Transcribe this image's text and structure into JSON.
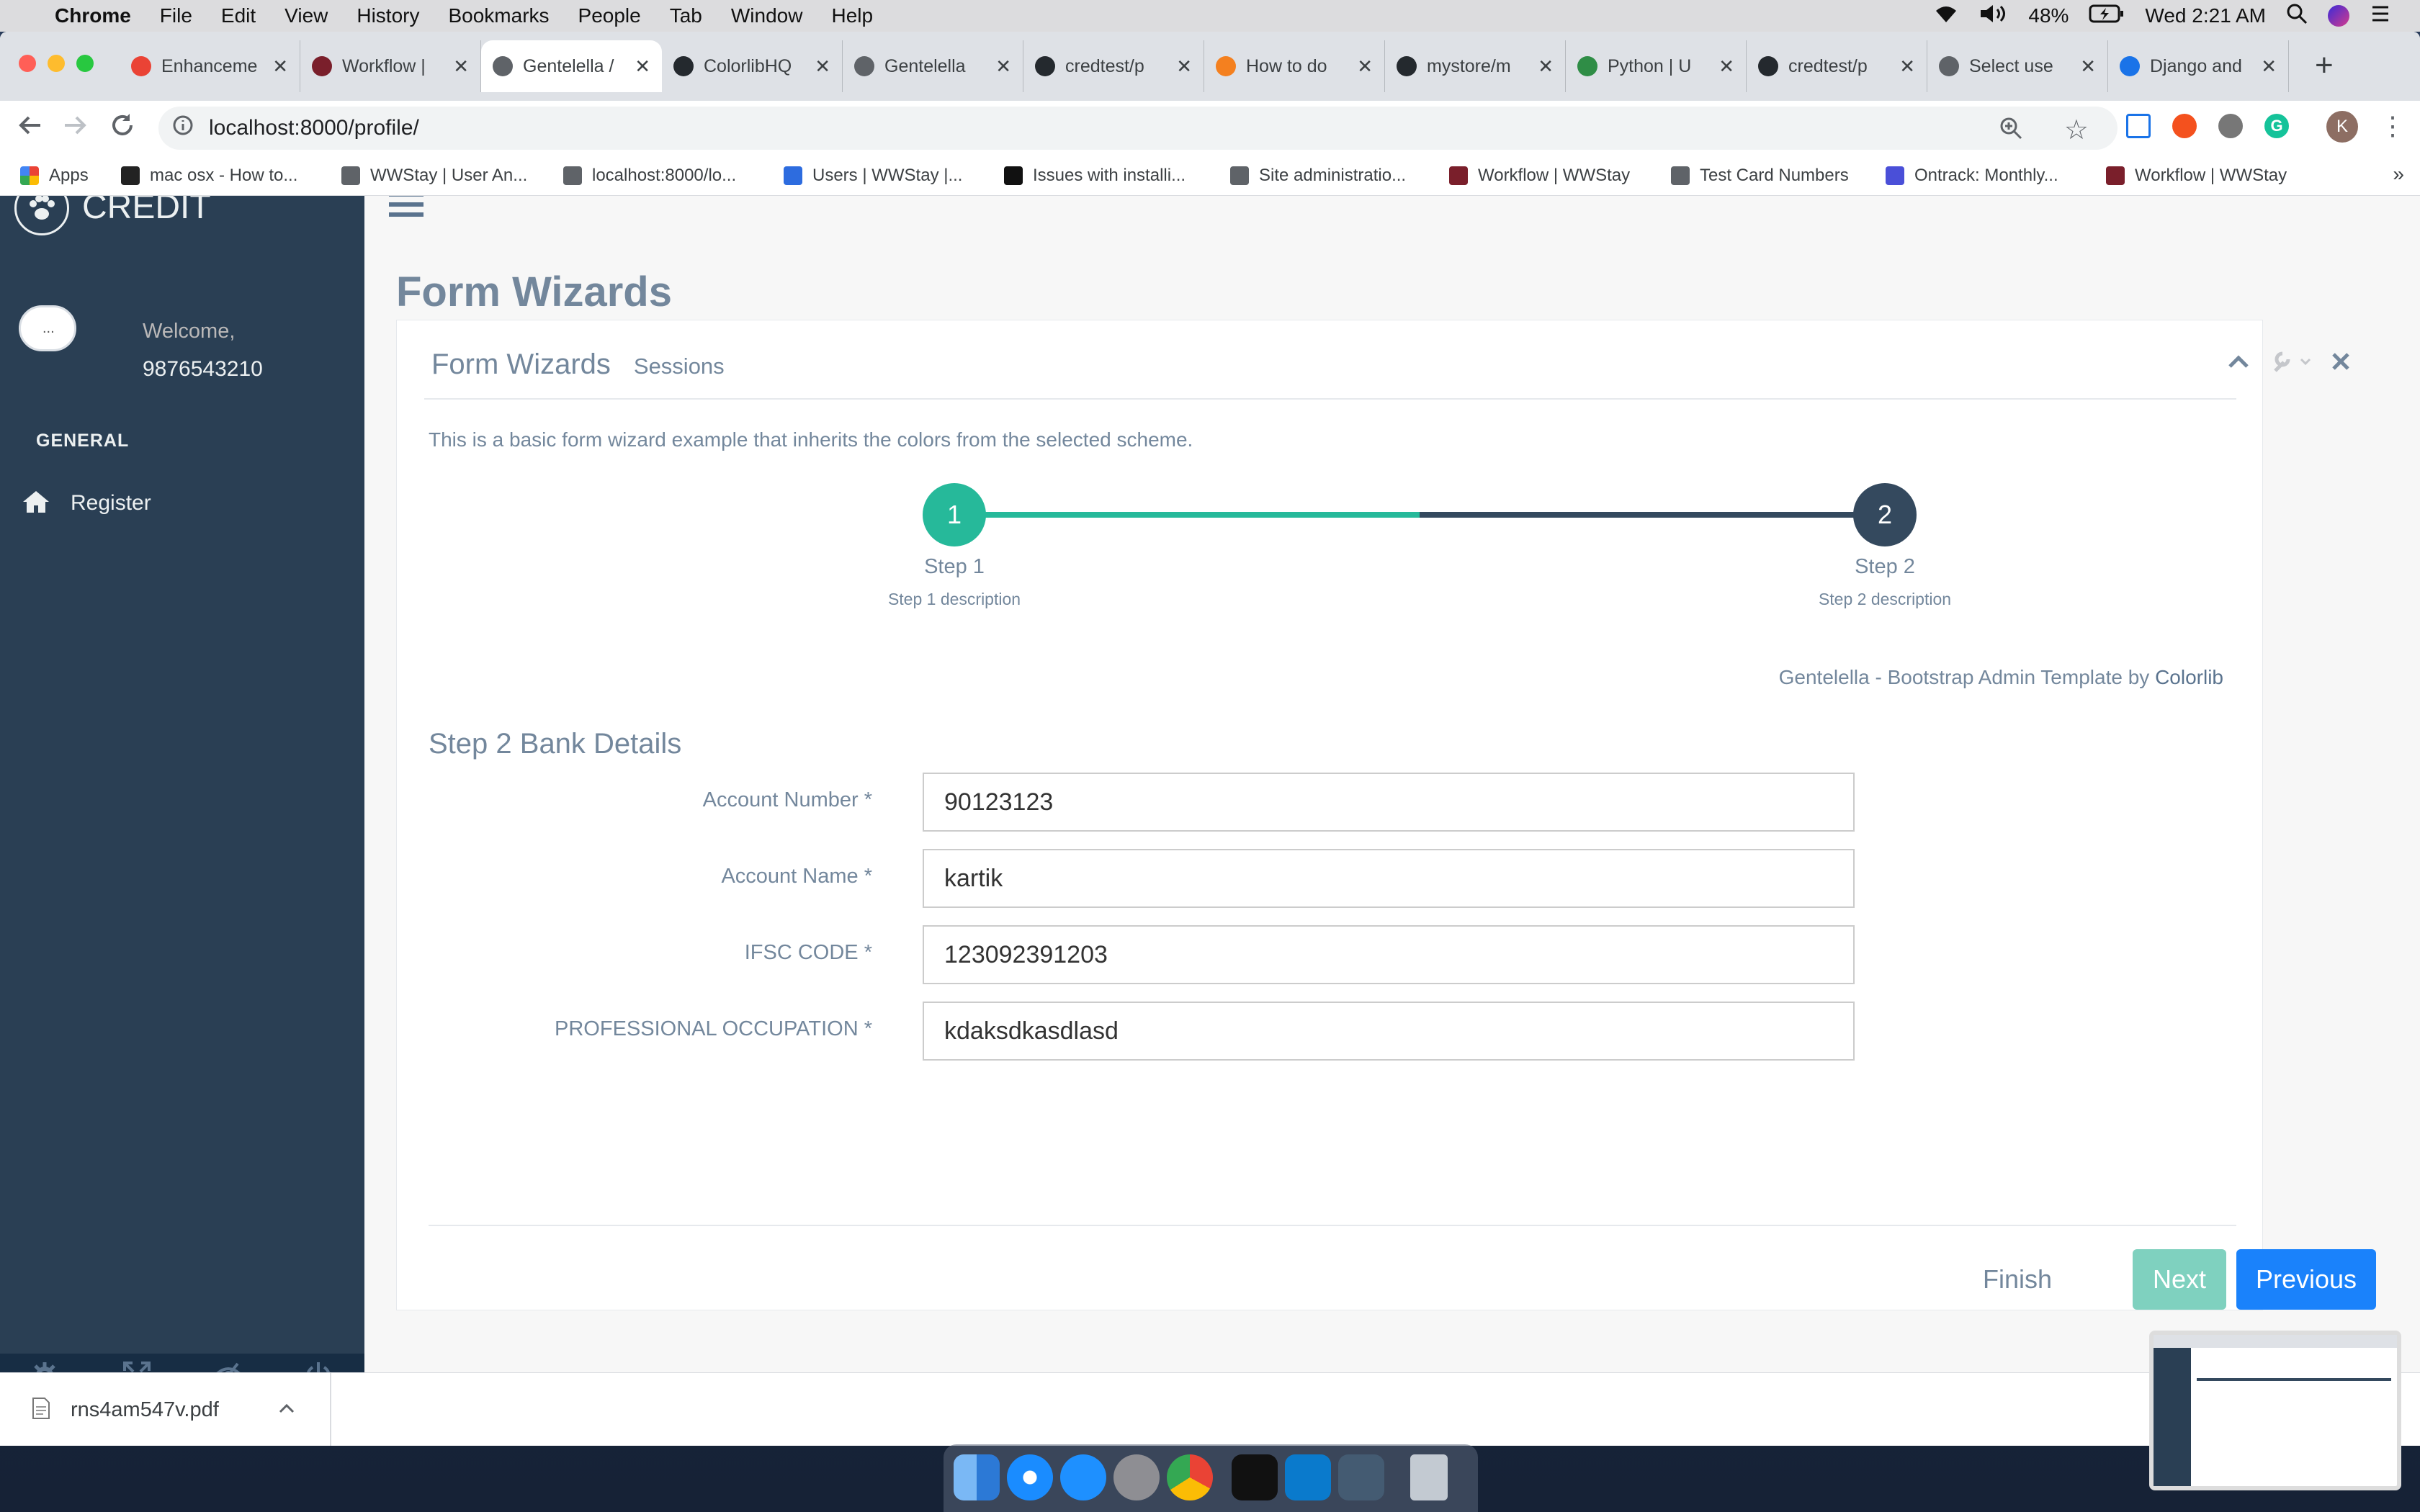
{
  "menubar": {
    "app": "Chrome",
    "items": [
      "File",
      "Edit",
      "View",
      "History",
      "Bookmarks",
      "People",
      "Tab",
      "Window",
      "Help"
    ],
    "battery": "48%",
    "clock": "Wed 2:21 AM"
  },
  "tabs": [
    {
      "title": "Enhanceme",
      "icon": "gmail-icon",
      "color": "#ea4335"
    },
    {
      "title": "Workflow | ",
      "icon": "wwstay-icon",
      "color": "#7a1f2b"
    },
    {
      "title": "Gentelella /",
      "icon": "globe-icon",
      "color": "#5f6368"
    },
    {
      "title": "ColorlibHQ",
      "icon": "github-icon",
      "color": "#24292e"
    },
    {
      "title": "Gentelella",
      "icon": "globe-icon",
      "color": "#5f6368"
    },
    {
      "title": "credtest/p",
      "icon": "github-icon",
      "color": "#24292e"
    },
    {
      "title": "How to do",
      "icon": "bolt-icon",
      "color": "#f4801f"
    },
    {
      "title": "mystore/m",
      "icon": "github-icon",
      "color": "#24292e"
    },
    {
      "title": "Python | U",
      "icon": "gfg-icon",
      "color": "#2f8d46"
    },
    {
      "title": "credtest/p",
      "icon": "github-icon",
      "color": "#24292e"
    },
    {
      "title": "Select use",
      "icon": "globe-icon",
      "color": "#5f6368"
    },
    {
      "title": "Django and",
      "icon": "loading-icon",
      "color": "#1a73e8"
    }
  ],
  "address": {
    "url": "localhost:8000/profile/"
  },
  "profile_initial": "K",
  "bookmarks": [
    {
      "label": "Apps",
      "color": "#e94335"
    },
    {
      "label": "mac osx - How to...",
      "color": "#222"
    },
    {
      "label": "WWStay | User An...",
      "color": "#5f6368"
    },
    {
      "label": "localhost:8000/lo...",
      "color": "#5f6368"
    },
    {
      "label": "Users | WWStay |...",
      "color": "#2d6cdf"
    },
    {
      "label": "Issues with installi...",
      "color": "#111"
    },
    {
      "label": "Site administratio...",
      "color": "#5f6368"
    },
    {
      "label": "Workflow | WWStay",
      "color": "#7a1f2b"
    },
    {
      "label": "Test Card Numbers",
      "color": "#5f6368"
    },
    {
      "label": "Ontrack: Monthly...",
      "color": "#4a4fd8"
    },
    {
      "label": "Workflow | WWStay",
      "color": "#7a1f2b"
    }
  ],
  "bookmarks_more": "»",
  "sidebar": {
    "brand": "CREDIT",
    "welcome": "Welcome,",
    "username": "9876543210",
    "avatar_alt": "...",
    "section": "GENERAL",
    "menu": [
      {
        "label": "Register",
        "icon": "home-icon"
      }
    ]
  },
  "page": {
    "title": "Form Wizards",
    "panel_title": "Form Wizards",
    "panel_subtitle": "Sessions",
    "intro": "This is a basic form wizard example that inherits the colors from the selected scheme.",
    "steps": [
      {
        "num": "1",
        "label": "Step 1",
        "desc": "Step 1 description",
        "state": "done"
      },
      {
        "num": "2",
        "label": "Step 2",
        "desc": "Step 2 description",
        "state": "current"
      }
    ],
    "credit_text": "Gentelella - Bootstrap Admin Template by ",
    "credit_link": "Colorlib",
    "form_title": "Step 2 Bank Details",
    "fields": [
      {
        "label": "Account Number *",
        "value": "90123123"
      },
      {
        "label": "Account Name *",
        "value": "kartik"
      },
      {
        "label": "IFSC CODE *",
        "value": "123092391203"
      },
      {
        "label": "PROFESSIONAL OCCUPATION *",
        "value": "kdaksdkasdlasd"
      }
    ],
    "buttons": {
      "finish": "Finish",
      "next": "Next",
      "previous": "Previous"
    }
  },
  "download": {
    "filename": "rns4am547v.pdf"
  },
  "colors": {
    "accent": "#26b99a",
    "dark": "#34495e",
    "primary": "#1a82fb",
    "sidebar": "#2a3f54",
    "muted": "#73879c"
  }
}
